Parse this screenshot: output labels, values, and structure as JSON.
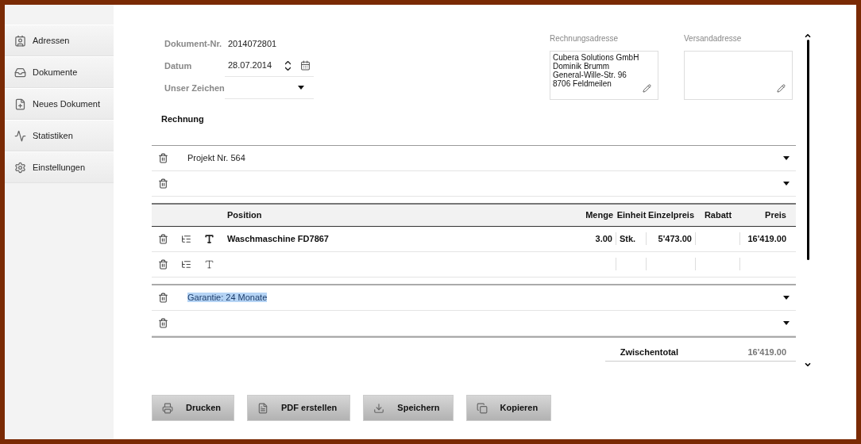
{
  "sidebar": {
    "items": [
      {
        "label": "Adressen",
        "selected": false
      },
      {
        "label": "Dokumente",
        "selected": false
      },
      {
        "label": "Neues Dokument",
        "selected": false
      },
      {
        "label": "Statistiken",
        "selected": false
      },
      {
        "label": "Einstellungen",
        "selected": false
      }
    ]
  },
  "header_fields": [
    {
      "kind": "text",
      "label": "Dokument-Nr.",
      "value": "2014072801"
    },
    {
      "kind": "date",
      "label": "Datum",
      "value": "28.07.2014"
    },
    {
      "kind": "select",
      "label": "Unser Zeichen"
    }
  ],
  "billing_address": {
    "label": "Rechnungsadresse",
    "lines": [
      "Cubera Solutions GmbH",
      "Dominik Brumm",
      "General-Wille-Str. 96",
      "8706 Feldmeilen"
    ]
  },
  "shipping_address": {
    "label": "Versandadresse"
  },
  "document_type": "Rechnung",
  "header_text_rows": [
    {
      "text": "Projekt Nr. 564",
      "selected": false
    },
    {
      "selected": false
    }
  ],
  "positions": {
    "columns": [
      "Position",
      "Menge",
      "Einheit",
      "Einzelpreis",
      "Rabatt",
      "Preis"
    ],
    "rows": [
      {
        "bold": true,
        "position": "Waschmaschine FD7867",
        "menge": "3.00",
        "einheit": "Stk.",
        "einzelpreis": "5'473.00",
        "preis": "16'419.00"
      },
      {
        "bold": false
      }
    ]
  },
  "footer_text_rows": [
    {
      "text": "Garantie: 24 Monate",
      "selected": true
    },
    {
      "selected": false
    }
  ],
  "totals": [
    {
      "label": "Zwischentotal",
      "value": "16'419.00"
    }
  ],
  "buttons": [
    {
      "label": "Drucken"
    },
    {
      "label": "PDF erstellen"
    },
    {
      "label": "Speichern"
    },
    {
      "label": "Kopieren"
    }
  ]
}
